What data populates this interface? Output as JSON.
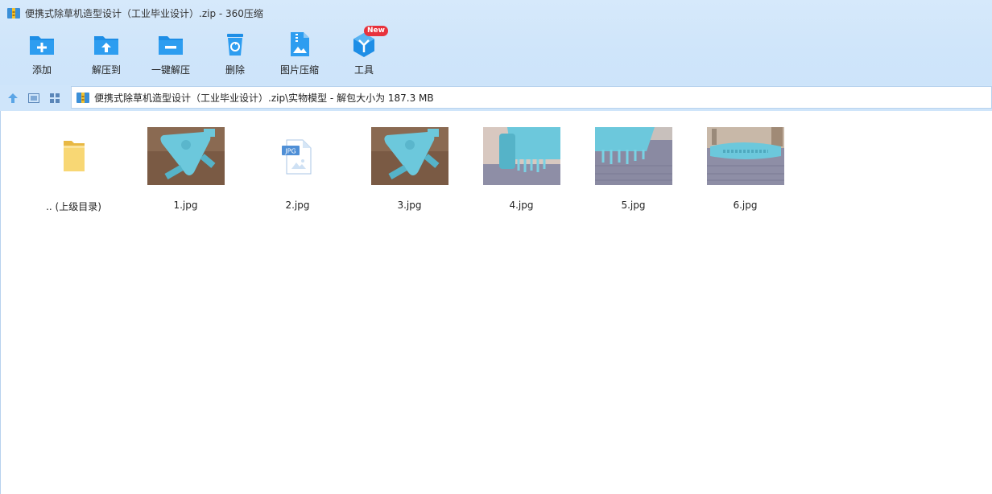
{
  "window": {
    "title": "便携式除草机造型设计（工业毕业设计）.zip - 360压缩"
  },
  "toolbar": {
    "items": [
      {
        "label": "添加",
        "icon": "add-folder-icon"
      },
      {
        "label": "解压到",
        "icon": "extract-folder-icon"
      },
      {
        "label": "一键解压",
        "icon": "one-click-extract-icon"
      },
      {
        "label": "删除",
        "icon": "recycle-bin-icon"
      },
      {
        "label": "图片压缩",
        "icon": "image-compress-icon"
      },
      {
        "label": "工具",
        "icon": "tools-cube-icon"
      }
    ],
    "new_badge": "New"
  },
  "address": {
    "path": "便携式除草机造型设计（工业毕业设计）.zip\\实物模型 - 解包大小为 187.3 MB"
  },
  "files": [
    {
      "name": ".. (上级目录)",
      "kind": "parent-folder"
    },
    {
      "name": "1.jpg",
      "kind": "photo"
    },
    {
      "name": "2.jpg",
      "kind": "jpg-placeholder"
    },
    {
      "name": "3.jpg",
      "kind": "photo"
    },
    {
      "name": "4.jpg",
      "kind": "photo"
    },
    {
      "name": "5.jpg",
      "kind": "photo"
    },
    {
      "name": "6.jpg",
      "kind": "photo"
    }
  ],
  "jpg_tag": "JPG",
  "colors": {
    "accent": "#1e8ee6",
    "chrome": "#cfe5fa",
    "badge": "#e8323c",
    "model_cyan": "#6cc8dc"
  }
}
